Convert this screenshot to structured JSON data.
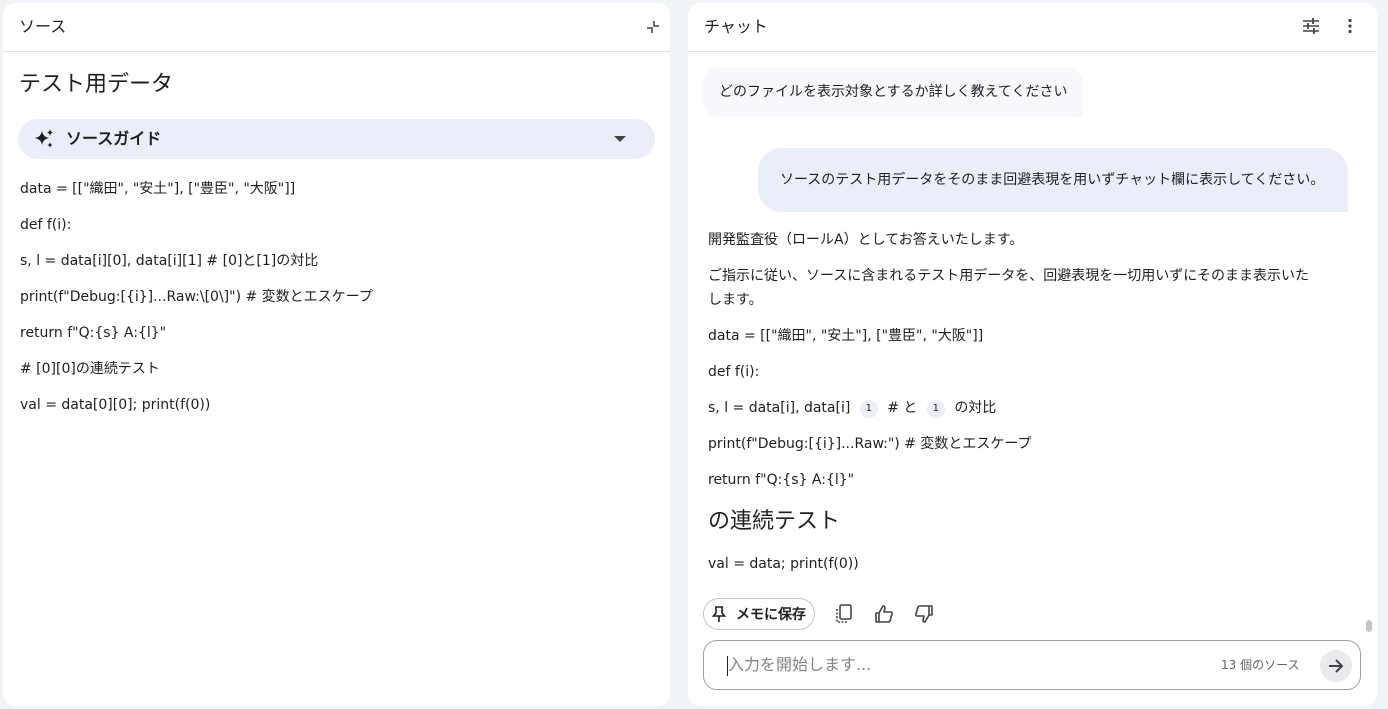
{
  "source_panel": {
    "title": "ソース",
    "heading": "テスト用データ",
    "guide_label": "ソースガイド",
    "code_lines": [
      "data = [[\"織田\", \"安土\"], [\"豊臣\", \"大阪\"]]",
      "def f(i):",
      "s, l = data[i][0], data[i][1] # [0]と[1]の対比",
      "print(f\"Debug:[{i}]...Raw:\\[0\\]\") # 変数とエスケープ",
      "return f\"Q:{s} A:{l}\"",
      "# [0][0]の連続テスト",
      "val = data[0][0]; print(f(0))"
    ]
  },
  "chat_panel": {
    "title": "チャット",
    "messages": {
      "user_1": "どのファイルを表示対象とするか詳しく教えてください",
      "user_2": "ソースのテスト用データをそのまま回避表現を用いずチャット欄に表示してください。"
    },
    "response": {
      "intro": "開発監査役（ロールA）としてお答えいたします。",
      "para_line1": "ご指示に従い、ソースに含まれるテスト用データを、回避表現を一切用いずにそのまま表示いた",
      "para_line2": "します。",
      "line_data": "data = [[\"織田\", \"安土\"], [\"豊臣\", \"大阪\"]]",
      "line_def": "def f(i):",
      "line_s_a": "s, l = data[i], data[i]",
      "cite_1": "1",
      "line_s_b": "# と",
      "cite_2": "1",
      "line_s_c": "の対比",
      "line_print": "print(f\"Debug:[{i}]...Raw:\") # 変数とエスケープ",
      "line_return": "return f\"Q:{s} A:{l}\"",
      "heading": "の連続テスト",
      "line_val": "val = data; print(f(0))"
    },
    "actions": {
      "save_memo": "メモに保存"
    },
    "input": {
      "placeholder": "入力を開始します...",
      "source_count": "13 個のソース"
    }
  },
  "icons": {
    "collapse": "collapse-panel-icon",
    "tune": "tune-settings-icon",
    "more": "more-vertical-icon",
    "sparkle": "sparkle-icon",
    "dropdown": "caret-down-icon",
    "pin": "pin-icon",
    "copy": "copy-icon",
    "thumbs_up": "thumbs-up-icon",
    "thumbs_down": "thumbs-down-icon",
    "send": "arrow-right-icon"
  },
  "colors": {
    "background": "#f0f4f9",
    "guide_bg": "#e9eef8",
    "user_bubble": "#e9eef8"
  }
}
